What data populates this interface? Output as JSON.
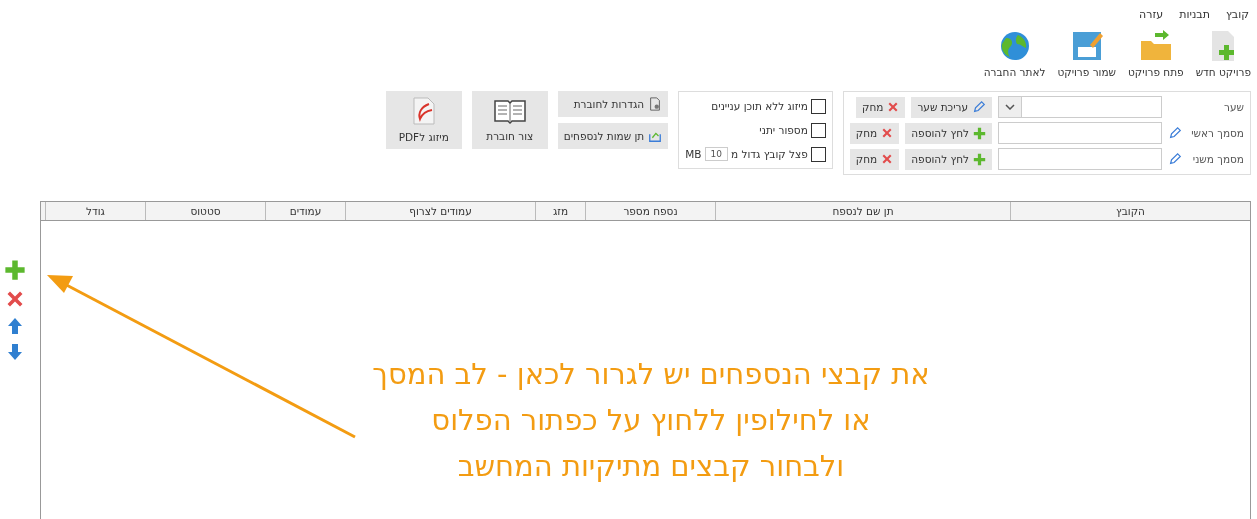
{
  "menu": [
    {
      "label": "קובץ"
    },
    {
      "label": "תבניות"
    },
    {
      "label": "עזרה"
    }
  ],
  "toolbar": [
    {
      "kind": "new",
      "label": "פרויקט חדש"
    },
    {
      "kind": "open",
      "label": "פתח פרויקט"
    },
    {
      "kind": "save",
      "label": "שמור פרויקט"
    },
    {
      "kind": "web",
      "label": "לאתר החברה"
    }
  ],
  "docs": [
    {
      "kind": "gate",
      "label": "שער",
      "action": "עריכת שער",
      "delete": "מחק"
    },
    {
      "kind": "file",
      "label": "מסמך ראשי",
      "action": "לחץ להוספה",
      "delete": "מחק"
    },
    {
      "kind": "file",
      "label": "מסמך משני",
      "action": "לחץ להוספה",
      "delete": "מחק"
    }
  ],
  "options": [
    {
      "kind": "check",
      "label": "מיזוג ללא תוכן עניינים",
      "checked": false
    },
    {
      "kind": "check",
      "label": "מספור יתני",
      "checked": false
    },
    {
      "kind": "split",
      "label": "פצל קובץ גדול מ",
      "checked": false,
      "value": "10",
      "unit": "MB"
    }
  ],
  "booklet_buttons": [
    {
      "kind": "settings",
      "label": "הגדרות לחוברת"
    },
    {
      "kind": "rename",
      "label": "תן שמות לנספחים"
    }
  ],
  "big_buttons": [
    {
      "kind": "book",
      "label": "צור חוברת"
    },
    {
      "kind": "pdf",
      "label": "מיזוג לPDF"
    }
  ],
  "table": {
    "columns": [
      "הקובץ",
      "תן שם לנספח",
      "נספח מספר",
      "מזג",
      "עמודים לצרוף",
      "עמודים",
      "סטטוס",
      "גודל"
    ]
  },
  "side_tools": [
    {
      "kind": "add"
    },
    {
      "kind": "remove"
    },
    {
      "kind": "up"
    },
    {
      "kind": "down"
    }
  ],
  "annotation": [
    "את קבצי הנספחים יש לגרור לכאן - לב המסך",
    "או לחילופין ללחוץ על כפתור הפלוס",
    "ולבחור קבצים מתיקיות המחשב"
  ]
}
